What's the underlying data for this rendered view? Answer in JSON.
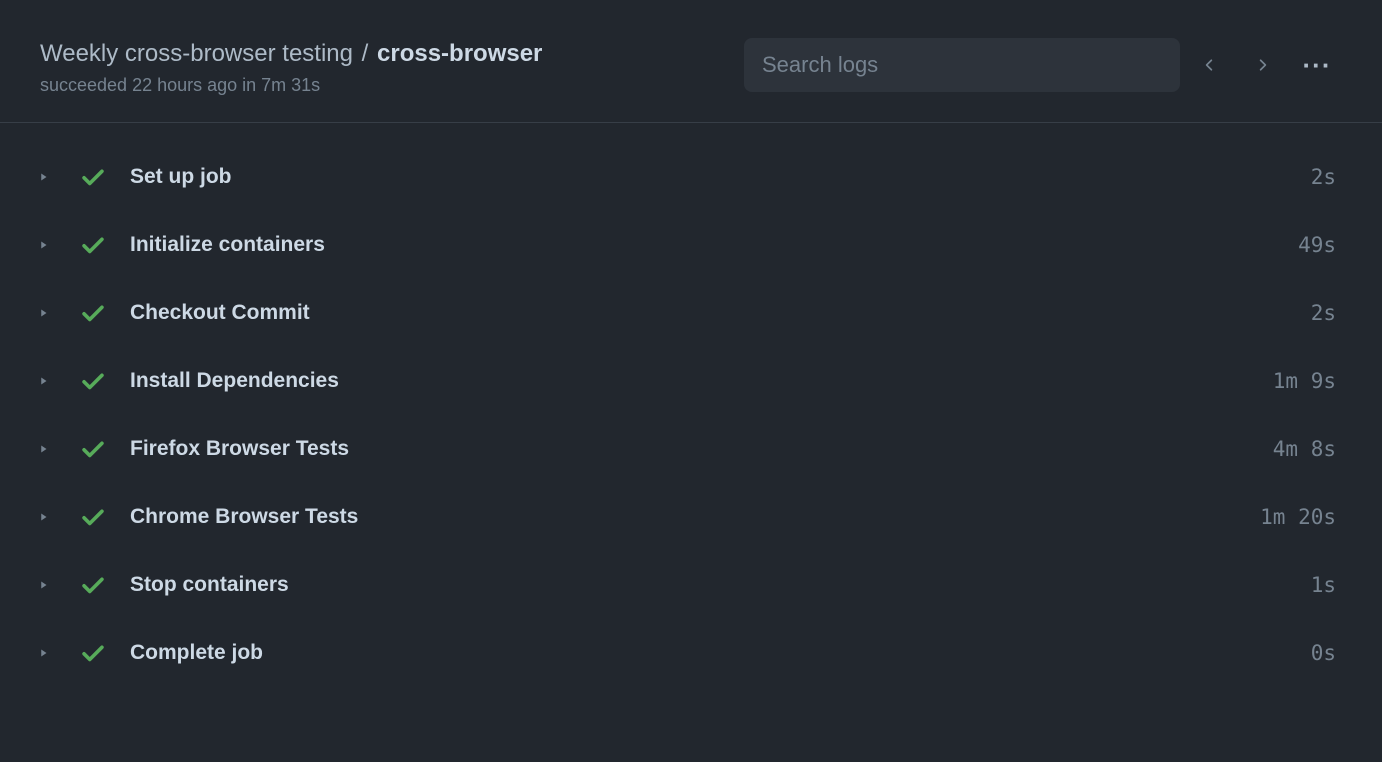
{
  "header": {
    "workflow_name": "Weekly cross-browser testing",
    "separator": "/",
    "job_name": "cross-browser",
    "status_text": "succeeded 22 hours ago in 7m 31s"
  },
  "search": {
    "placeholder": "Search logs"
  },
  "steps": [
    {
      "name": "Set up job",
      "duration": "2s"
    },
    {
      "name": "Initialize containers",
      "duration": "49s"
    },
    {
      "name": "Checkout Commit",
      "duration": "2s"
    },
    {
      "name": "Install Dependencies",
      "duration": "1m 9s"
    },
    {
      "name": "Firefox Browser Tests",
      "duration": "4m 8s"
    },
    {
      "name": "Chrome Browser Tests",
      "duration": "1m 20s"
    },
    {
      "name": "Stop containers",
      "duration": "1s"
    },
    {
      "name": "Complete job",
      "duration": "0s"
    }
  ]
}
